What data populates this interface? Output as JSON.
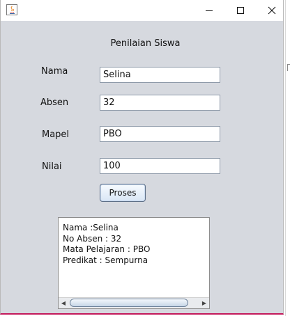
{
  "window": {
    "title": "",
    "icon": "java-icon",
    "controls": [
      "minimize-icon",
      "maximize-icon",
      "close-icon"
    ]
  },
  "form": {
    "heading": "Penilaian Siswa",
    "fields": [
      {
        "label": "Nama",
        "value": "Selina"
      },
      {
        "label": "Absen",
        "value": "32"
      },
      {
        "label": "Mapel",
        "value": "PBO"
      },
      {
        "label": "Nilai",
        "value": "100"
      }
    ],
    "button_label": "Proses"
  },
  "output": {
    "lines": [
      "Nama :Selina",
      "No Absen : 32",
      "Mata Pelajaran : PBO",
      "Predikat : Sempurna"
    ]
  },
  "colors": {
    "window_bg": "#d6d9df",
    "frame_accent": "#c3185a"
  }
}
